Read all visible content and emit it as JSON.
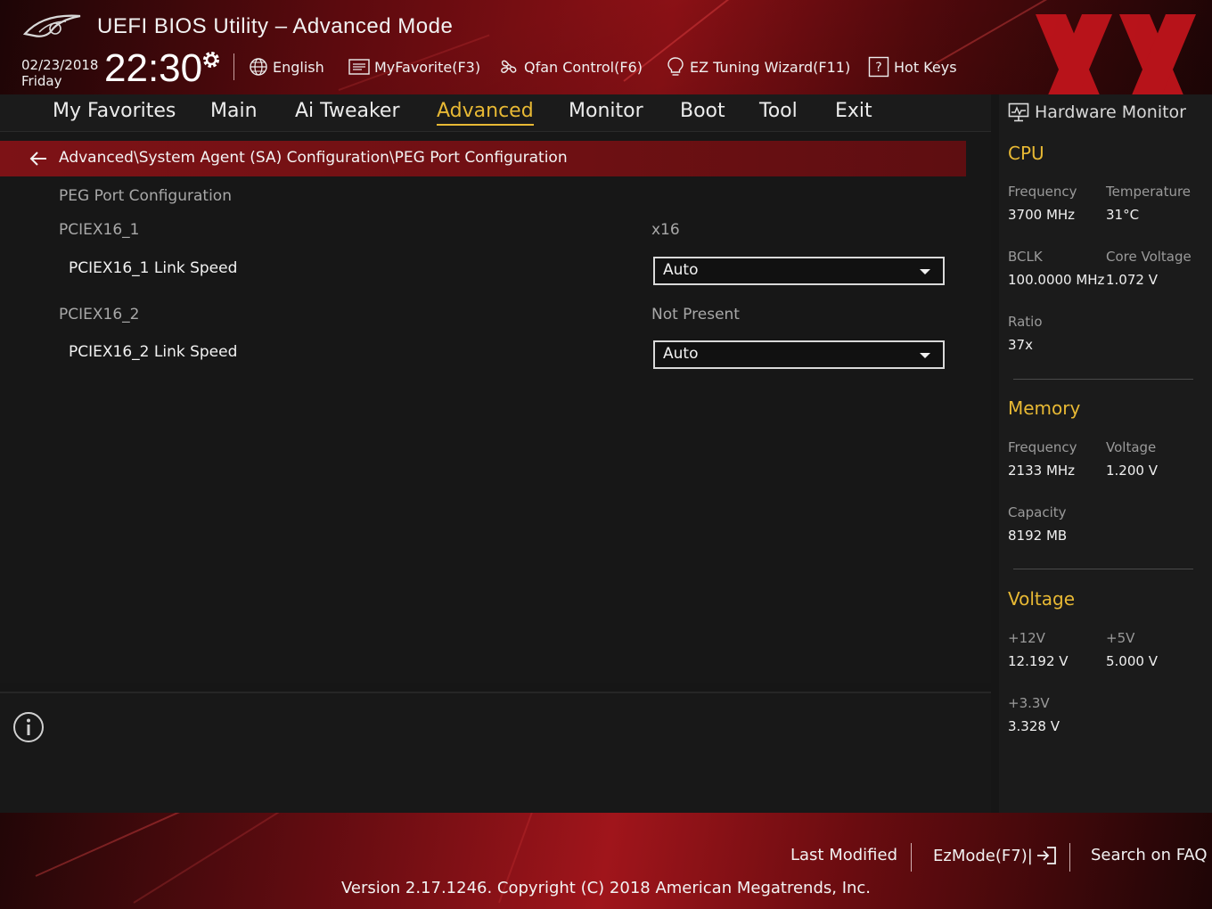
{
  "header": {
    "app_title": "UEFI BIOS Utility – Advanced Mode",
    "date": "02/23/2018",
    "day": "Friday",
    "time": "22:30",
    "tools": {
      "language": "English",
      "my_favorite": "MyFavorite(F3)",
      "qfan": "Qfan Control(F6)",
      "ez_tuning": "EZ Tuning Wizard(F11)",
      "hot_keys": "Hot Keys"
    }
  },
  "nav": {
    "tabs": [
      "My Favorites",
      "Main",
      "Ai Tweaker",
      "Advanced",
      "Monitor",
      "Boot",
      "Tool",
      "Exit"
    ],
    "active": "Advanced"
  },
  "main": {
    "breadcrumb": "Advanced\\System Agent (SA) Configuration\\PEG Port Configuration",
    "section_title": "PEG Port Configuration",
    "port1": {
      "label": "PCIEX16_1",
      "value": "x16"
    },
    "port1_speed": {
      "label": "PCIEX16_1 Link Speed",
      "value": "Auto"
    },
    "port2": {
      "label": "PCIEX16_2",
      "value": "Not Present"
    },
    "port2_speed": {
      "label": "PCIEX16_2 Link Speed",
      "value": "Auto"
    }
  },
  "hwmon": {
    "title": "Hardware Monitor",
    "cpu": {
      "heading": "CPU",
      "freq_label": "Frequency",
      "freq": "3700 MHz",
      "temp_label": "Temperature",
      "temp": "31°C",
      "bclk_label": "BCLK",
      "bclk": "100.0000 MHz",
      "vcore_label": "Core Voltage",
      "vcore": "1.072 V",
      "ratio_label": "Ratio",
      "ratio": "37x"
    },
    "memory": {
      "heading": "Memory",
      "freq_label": "Frequency",
      "freq": "2133 MHz",
      "volt_label": "Voltage",
      "volt": "1.200 V",
      "cap_label": "Capacity",
      "cap": "8192 MB"
    },
    "voltage": {
      "heading": "Voltage",
      "v12_label": "+12V",
      "v12": "12.192 V",
      "v5_label": "+5V",
      "v5": "5.000 V",
      "v33_label": "+3.3V",
      "v33": "3.328 V"
    }
  },
  "footer": {
    "last_modified": "Last Modified",
    "ezmode": "EzMode(F7)|",
    "search_faq": "Search on FAQ",
    "version": "Version 2.17.1246. Copyright (C) 2018 American Megatrends, Inc."
  },
  "colors": {
    "accent": "#e8b934",
    "brand_red": "#8e1116",
    "breadcrumb_bg": "#7d1216"
  }
}
